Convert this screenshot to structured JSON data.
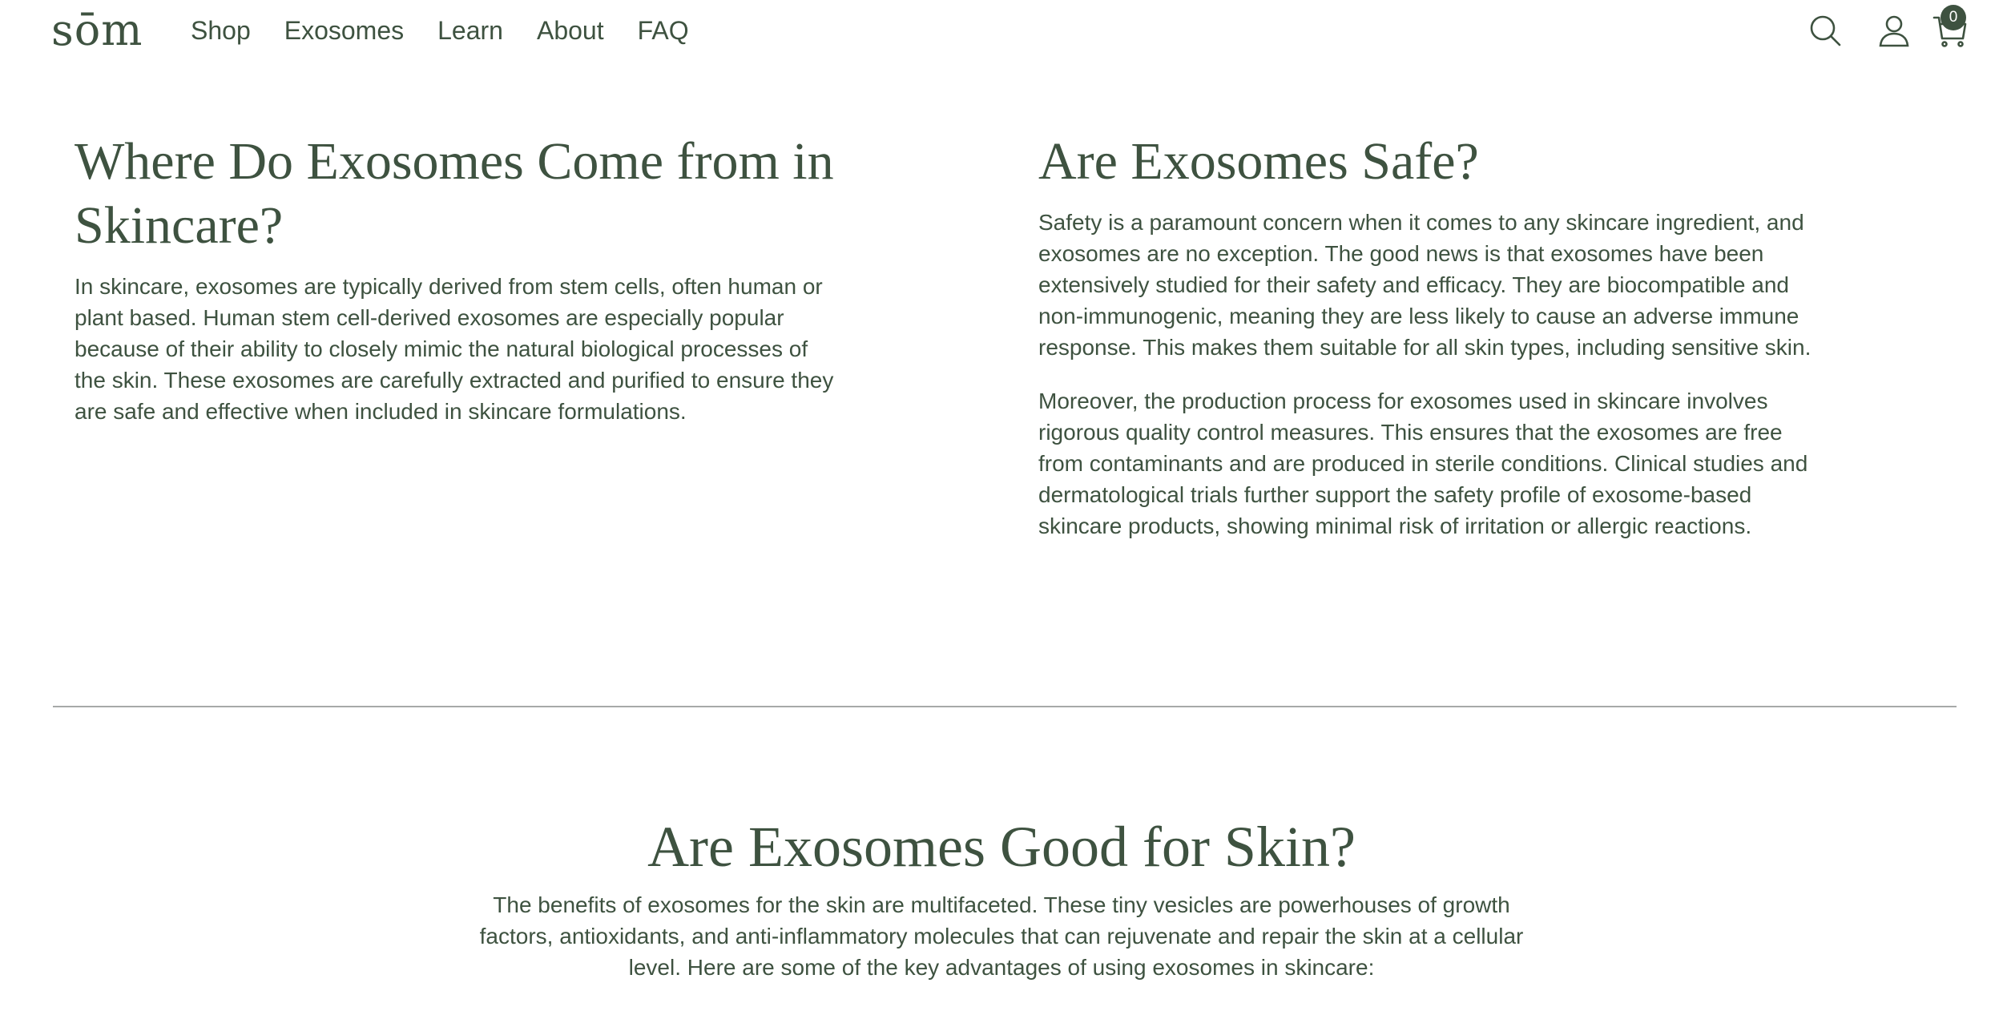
{
  "header": {
    "logo": "sōm",
    "nav": [
      "Shop",
      "Exosomes",
      "Learn",
      "About",
      "FAQ"
    ],
    "icons": [
      "search-icon",
      "account-icon",
      "cart-icon"
    ],
    "cart_count": "0"
  },
  "left": {
    "title": "Where Do Exosomes Come from in Skincare?",
    "paragraph": "In skincare, exosomes are typically derived from stem cells, often human or plant based. Human stem cell-derived exosomes are especially popular because of their ability to closely mimic the natural biological processes of the skin. These exosomes are carefully extracted and purified to ensure they are safe and effective when included in skincare formulations."
  },
  "right": {
    "title": "Are Exosomes Safe?",
    "paragraph1": "Safety is a paramount concern when it comes to any skincare ingredient, and exosomes are no exception. The good news is that exosomes have been extensively studied for their safety and efficacy. They are biocompatible and non-immunogenic, meaning they are less likely to cause an adverse immune response. This makes them suitable for all skin types, including sensitive skin.",
    "paragraph2": "Moreover, the production process for exosomes used in skincare involves rigorous quality control measures. This ensures that the exosomes are free from contaminants and are produced in sterile conditions. Clinical studies and dermatological trials further support the safety profile of exosome-based skincare products, showing minimal risk of irritation or allergic reactions."
  },
  "center": {
    "title": "Are Exosomes Good for Skin?",
    "paragraph": "The benefits of exosomes for the skin are multifaceted. These tiny vesicles are powerhouses of growth factors, antioxidants, and anti-inflammatory molecules that can rejuvenate and repair the skin at a cellular level. Here are some of the key advantages of using exosomes in skincare:"
  },
  "colors": {
    "text": "#3e5240",
    "divider": "#a7a9a8",
    "background": "#ffffff"
  }
}
